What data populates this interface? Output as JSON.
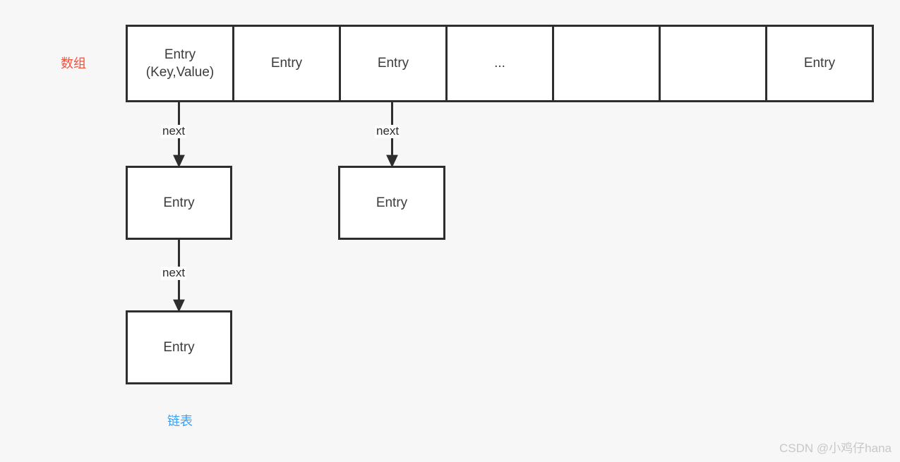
{
  "diagram": {
    "title": "HashMap structure: array of buckets with linked-list chaining",
    "background_color": "#f7f7f7",
    "stroke_color": "#2e2e2e",
    "box_fill": "#ffffff"
  },
  "captions": {
    "array": {
      "text": "数组",
      "color": "#f4503c"
    },
    "linked_list": {
      "text": "链表",
      "color": "#3ba0f5"
    }
  },
  "array": {
    "cell_count": 7,
    "cells": [
      {
        "index": 0,
        "label": "Entry\n(Key,Value)"
      },
      {
        "index": 1,
        "label": "Entry"
      },
      {
        "index": 2,
        "label": "Entry"
      },
      {
        "index": 3,
        "label": "..."
      },
      {
        "index": 4,
        "label": ""
      },
      {
        "index": 5,
        "label": ""
      },
      {
        "index": 6,
        "label": "Entry"
      }
    ]
  },
  "nodes": [
    {
      "id": "node-a",
      "label": "Entry"
    },
    {
      "id": "node-b",
      "label": "Entry"
    },
    {
      "id": "node-c",
      "label": "Entry"
    }
  ],
  "edges": [
    {
      "id": "edge-1",
      "label": "next",
      "from": "array-cell-0",
      "to": "node-a"
    },
    {
      "id": "edge-2",
      "label": "next",
      "from": "array-cell-2",
      "to": "node-b"
    },
    {
      "id": "edge-3",
      "label": "next",
      "from": "node-a",
      "to": "node-c"
    }
  ],
  "watermark": {
    "text": "CSDN @小鸡仔hana",
    "color": "#c8c8c8"
  }
}
